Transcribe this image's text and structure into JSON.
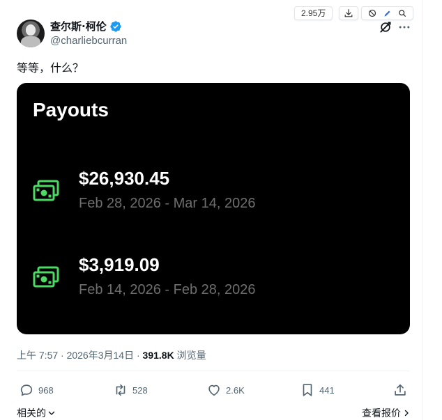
{
  "author": {
    "display_name": "查尔斯·柯伦",
    "handle": "@charliebcurran",
    "verified": true
  },
  "toolbar": {
    "count": "2.95万",
    "icons": [
      "download-icon",
      "block-icon",
      "pen-icon",
      "search-icon"
    ]
  },
  "tweet": {
    "text": "等等，什么？"
  },
  "card": {
    "title": "Payouts",
    "payouts": [
      {
        "amount": "$26,930.45",
        "range": "Feb 28, 2026 - Mar 14, 2026"
      },
      {
        "amount": "$3,919.09",
        "range": "Feb 14, 2026 - Feb 28, 2026"
      }
    ],
    "accent": "#4cd964"
  },
  "meta": {
    "time": "上午 7:57 · 2026年3月14日 · ",
    "views_count": "391.8K",
    "views_label": " 浏览量"
  },
  "actions": {
    "replies": "968",
    "reposts": "528",
    "likes": "2.6K",
    "bookmarks": "441"
  },
  "footer": {
    "related": "相关的",
    "quotes": "查看报价"
  }
}
